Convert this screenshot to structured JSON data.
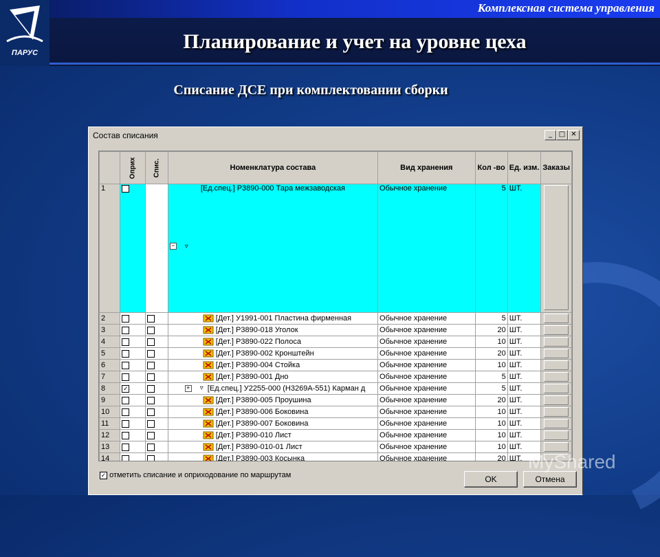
{
  "header": {
    "brand_text": "Комплексная система управления",
    "title": "Планирование и учет на уровне цеха",
    "subtitle": "Списание ДСЕ при комплектовании сборки",
    "logo_text": "ПАРУС"
  },
  "window": {
    "title": "Состав списания",
    "controls": {
      "minimize": "_",
      "maximize": "□",
      "close": "✕"
    },
    "columns": {
      "opriх": "Оприх",
      "spis": "Спис.",
      "nomenclature": "Номенклатура состава",
      "storage": "Вид хранения",
      "qty": "Кол -во",
      "unit": "Ед. изм.",
      "orders": "Заказы"
    },
    "rows": [
      {
        "num": "1",
        "opr": false,
        "spis": false,
        "nom": "[Ед.спец.] Р3890-000 Тара межзаводская",
        "storage": "Обычное хранение",
        "qty": "5",
        "unit": "ШТ."
      },
      {
        "num": "2",
        "opr": false,
        "spis": false,
        "nom": "[Дет.] У1991-001 Пластина фирменная",
        "storage": "Обычное хранение",
        "qty": "5",
        "unit": "ШТ."
      },
      {
        "num": "3",
        "opr": false,
        "spis": false,
        "nom": "[Дет.] Р3890-018 Уголок",
        "storage": "Обычное хранение",
        "qty": "20",
        "unit": "ШТ."
      },
      {
        "num": "4",
        "opr": false,
        "spis": false,
        "nom": "[Дет.] Р3890-022 Полоса",
        "storage": "Обычное хранение",
        "qty": "10",
        "unit": "ШТ."
      },
      {
        "num": "5",
        "opr": false,
        "spis": false,
        "nom": "[Дет.] Р3890-002 Кронштейн",
        "storage": "Обычное хранение",
        "qty": "20",
        "unit": "ШТ."
      },
      {
        "num": "6",
        "opr": false,
        "spis": false,
        "nom": "[Дет.] Р3890-004 Стойка",
        "storage": "Обычное хранение",
        "qty": "10",
        "unit": "ШТ."
      },
      {
        "num": "7",
        "opr": false,
        "spis": false,
        "nom": "[Дет.] Р3890-001 Дно",
        "storage": "Обычное хранение",
        "qty": "5",
        "unit": "ШТ."
      },
      {
        "num": "8",
        "opr": true,
        "spis": false,
        "nom": "[Ед.спец.] У2255-000 (Н3269А-551) Карман д",
        "storage": "Обычное хранение",
        "qty": "5",
        "unit": "ШТ."
      },
      {
        "num": "9",
        "opr": false,
        "spis": false,
        "nom": "[Дет.] Р3890-005 Проушина",
        "storage": "Обычное хранение",
        "qty": "20",
        "unit": "ШТ."
      },
      {
        "num": "10",
        "opr": false,
        "spis": false,
        "nom": "[Дет.] Р3890-006 Боковина",
        "storage": "Обычное хранение",
        "qty": "10",
        "unit": "ШТ."
      },
      {
        "num": "11",
        "opr": false,
        "spis": false,
        "nom": "[Дет.] Р3890-007 Боковина",
        "storage": "Обычное хранение",
        "qty": "10",
        "unit": "ШТ."
      },
      {
        "num": "12",
        "opr": false,
        "spis": false,
        "nom": "[Дет.] Р3890-010 Лист",
        "storage": "Обычное хранение",
        "qty": "10",
        "unit": "ШТ."
      },
      {
        "num": "13",
        "opr": false,
        "spis": false,
        "nom": "[Дет.] Р3890-010-01 Лист",
        "storage": "Обычное хранение",
        "qty": "10",
        "unit": "ШТ."
      },
      {
        "num": "14",
        "opr": false,
        "spis": false,
        "nom": "[Дет.] Р3890-003 Косынка",
        "storage": "Обычное хранение",
        "qty": "20",
        "unit": "ШТ."
      }
    ],
    "route_checkbox_label": "отметить списание и оприходование по маршрутам",
    "route_checkbox_checked": true,
    "ok_label": "OK",
    "cancel_label": "Отмена"
  },
  "watermark": "MyShared",
  "colors": {
    "selected_row": "#00ffff",
    "title_band": "#1a3cf0",
    "background": "#123d8a"
  }
}
